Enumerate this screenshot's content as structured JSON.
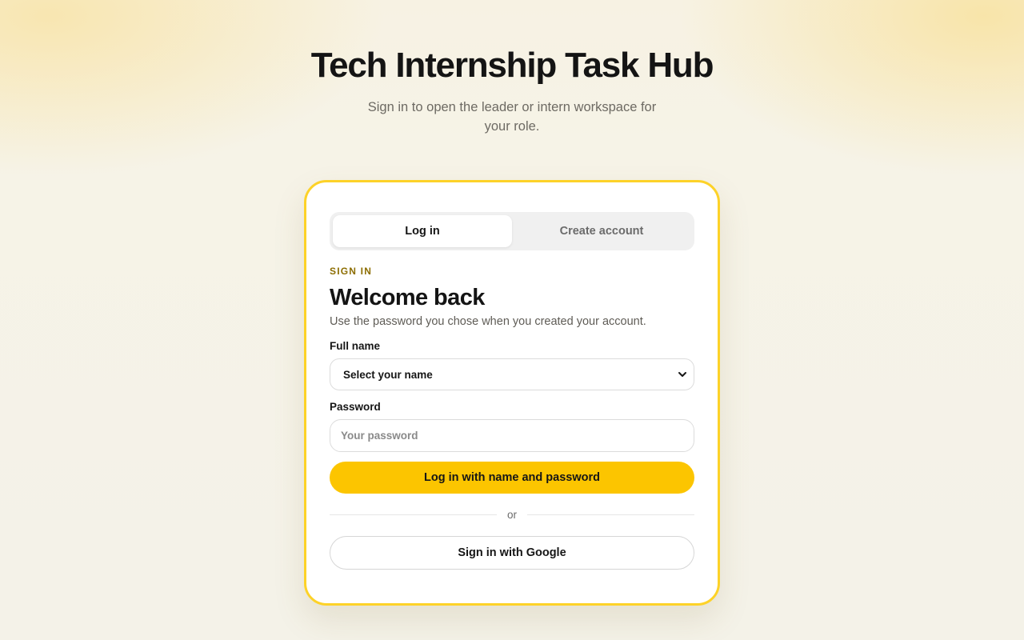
{
  "app": {
    "title": "Tech Internship Task Hub",
    "subtitle": "Sign in to open the leader or intern workspace for your role."
  },
  "tabs": [
    {
      "label": "Log in",
      "active": true
    },
    {
      "label": "Create account",
      "active": false
    }
  ],
  "form": {
    "eyebrow": "SIGN IN",
    "heading": "Welcome back",
    "description": "Use the password you chose when you created your account.",
    "name_label": "Full name",
    "name_select_value": "Select your name",
    "password_label": "Password",
    "password_placeholder": "Your password",
    "submit_label": "Log in with name and password",
    "divider_text": "or",
    "google_label": "Sign in with Google"
  },
  "colors": {
    "accent": "#fcc500",
    "card_border": "#fdd228",
    "eyebrow": "#8c6d00"
  },
  "icons": {
    "select_chevron": "chevron-down-icon"
  }
}
